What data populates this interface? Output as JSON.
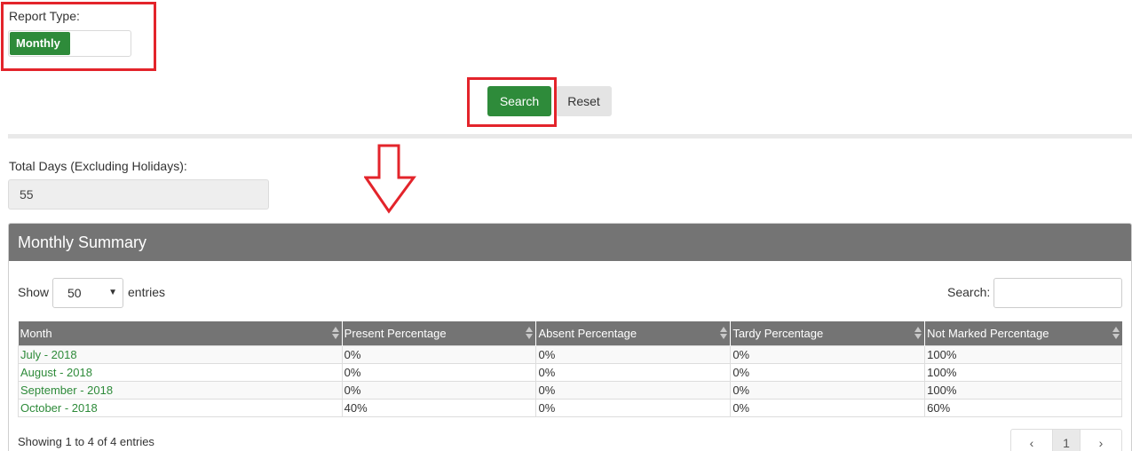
{
  "report_type": {
    "label": "Report Type:",
    "toggle_value": "Monthly"
  },
  "actions": {
    "search_label": "Search",
    "reset_label": "Reset"
  },
  "total_days": {
    "label": "Total Days (Excluding Holidays):",
    "value": "55"
  },
  "panel": {
    "title": "Monthly Summary",
    "show_label": "Show",
    "entries_value": "50",
    "entries_label": "entries",
    "search_label": "Search:"
  },
  "table": {
    "columns": [
      "Month",
      "Present Percentage",
      "Absent Percentage",
      "Tardy Percentage",
      "Not Marked Percentage"
    ],
    "rows": [
      [
        "July - 2018",
        "0%",
        "0%",
        "0%",
        "100%"
      ],
      [
        "August - 2018",
        "0%",
        "0%",
        "0%",
        "100%"
      ],
      [
        "September - 2018",
        "0%",
        "0%",
        "0%",
        "100%"
      ],
      [
        "October - 2018",
        "40%",
        "0%",
        "0%",
        "60%"
      ]
    ]
  },
  "footer": {
    "info": "Showing 1 to 4 of 4 entries",
    "prev": "‹",
    "current_page": "1",
    "next": "›"
  },
  "colors": {
    "accent": "#2e8b3a",
    "highlight": "#e3242b",
    "header": "#747474"
  }
}
